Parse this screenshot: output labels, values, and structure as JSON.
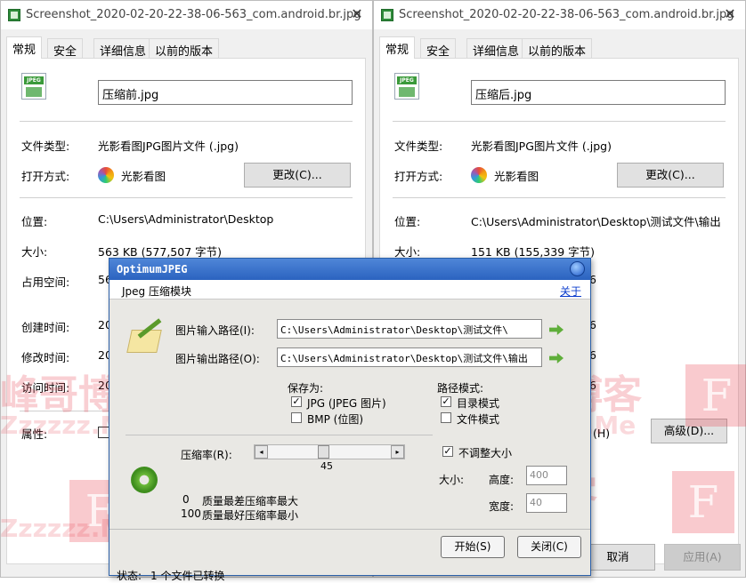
{
  "colors": {
    "dialog_title": "#2b63c0",
    "watermark": "#e84050",
    "panel_bg": "#ffffff",
    "window_bg": "#f0f0f0"
  },
  "left_window": {
    "title": "Screenshot_2020-02-20-22-38-06-563_com.android.br.jpg",
    "close": "✕",
    "tabs": [
      "常规",
      "安全",
      "详细信息",
      "以前的版本"
    ],
    "icon_label": "JPEG",
    "filename": "压缩前.jpg",
    "type_label": "文件类型:",
    "type_value": "光影看图JPG图片文件 (.jpg)",
    "open_label": "打开方式:",
    "open_app": "光影看图",
    "change_button": "更改(C)...",
    "location_label": "位置:",
    "location_value": "C:\\Users\\Administrator\\Desktop",
    "size_label": "大小:",
    "size_value": "563 KB (577,507 字节)",
    "disk_label": "占用空间:",
    "disk_value": "56",
    "created_label": "创建时间:",
    "created_value": "20",
    "modified_label": "修改时间:",
    "modified_value": "20",
    "accessed_label": "访问时间:",
    "accessed_value": "20",
    "attr_label": "属性:"
  },
  "right_window": {
    "title": "Screenshot_2020-02-20-22-38-06-563_com.android.br.jpg",
    "close": "✕",
    "tabs": [
      "常规",
      "安全",
      "详细信息",
      "以前的版本"
    ],
    "icon_label": "JPEG",
    "filename": "压缩后.jpg",
    "type_label": "文件类型:",
    "type_value": "光影看图JPG图片文件 (.jpg)",
    "open_label": "打开方式:",
    "open_app": "光影看图",
    "change_button": "更改(C)...",
    "location_label": "位置:",
    "location_value": "C:\\Users\\Administrator\\Desktop\\测试文件\\输出",
    "size_label": "大小:",
    "size_value": "151 KB (155,339 字节)",
    "disk_value": "56",
    "created_value": "56",
    "modified_value": "56",
    "accessed_value": "56",
    "attr_partial": "(H)",
    "advanced_button": "高级(D)...",
    "cancel_button": "取消",
    "apply_button": "应用(A)"
  },
  "dialog": {
    "title": "OptimumJPEG",
    "subtitle": "Jpeg 压缩模块",
    "about_link": "关于",
    "input_label": "图片输入路径(I):",
    "input_value": "C:\\Users\\Administrator\\Desktop\\测试文件\\",
    "output_label": "图片输出路径(O):",
    "output_value": "C:\\Users\\Administrator\\Desktop\\测试文件\\输出",
    "save_as_label": "保存为:",
    "jpg_option": "JPG (JPEG 图片)",
    "jpg_checked": true,
    "bmp_option": "BMP (位图)",
    "bmp_checked": false,
    "path_mode_label": "路径模式:",
    "dir_mode": "目录模式",
    "dir_checked": true,
    "file_mode": "文件模式",
    "file_checked": false,
    "ratio_label": "压缩率(R):",
    "ratio_value": "45",
    "ratio_fraction": 0.45,
    "keep_size_label": "不调整大小",
    "keep_size_checked": true,
    "size_label": "大小:",
    "height_label": "高度:",
    "height_value": "400",
    "width_label": "宽度:",
    "width_value": "40",
    "hint_0_num": "0",
    "hint_0_text": "质量最差压缩率最大",
    "hint_100_num": "100",
    "hint_100_text": "质量最好压缩率最小",
    "status_label": "状态:",
    "status_text": "1 个文件已转换",
    "start_button": "开始(S)",
    "close_button": "关闭(C)"
  },
  "watermark": {
    "brand": "峰哥博客",
    "domain": "Zzzzzz.Me",
    "letter": "F"
  }
}
